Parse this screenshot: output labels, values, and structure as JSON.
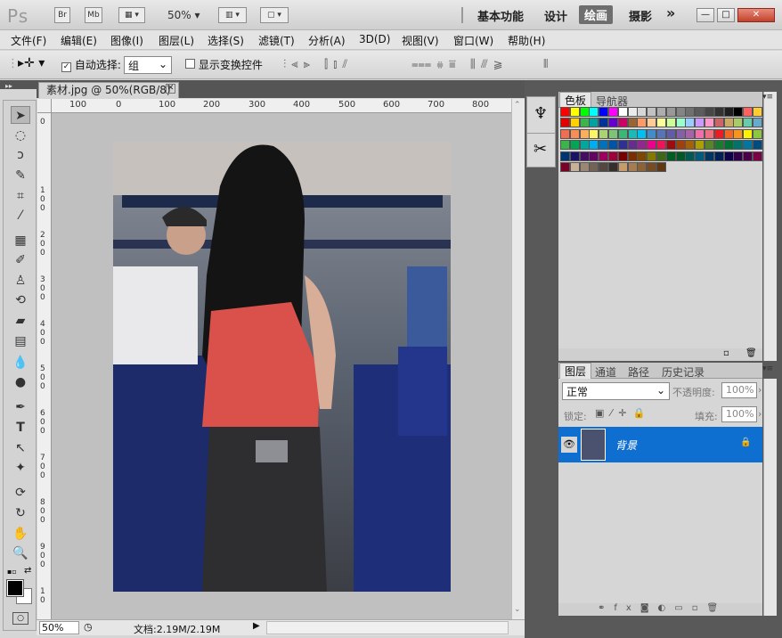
{
  "titlebar": {
    "logo": "Ps",
    "bridge": "Br",
    "minibridge": "Mb",
    "zoom": "50%",
    "workspaces": [
      "基本功能",
      "设计",
      "绘画",
      "摄影"
    ],
    "active_workspace": "绘画",
    "more": "»"
  },
  "menu": [
    "文件(F)",
    "编辑(E)",
    "图像(I)",
    "图层(L)",
    "选择(S)",
    "滤镜(T)",
    "分析(A)",
    "3D(D)",
    "视图(V)",
    "窗口(W)",
    "帮助(H)"
  ],
  "options": {
    "auto_select_label": "自动选择:",
    "auto_select_value": "组",
    "show_transform_label": "显示变换控件"
  },
  "document": {
    "tab_title": "素材.jpg @ 50%(RGB/8)",
    "ruler_top": [
      "100",
      "0",
      "100",
      "200",
      "300",
      "400",
      "500",
      "600",
      "700",
      "800"
    ],
    "ruler_left": [
      "0",
      "1\n0\n0",
      "2\n0\n0",
      "3\n0\n0",
      "4\n0\n0",
      "5\n0\n0",
      "6\n0\n0",
      "7\n0\n0",
      "8\n0\n0",
      "9\n0\n0",
      "1\n0"
    ],
    "zoom": "50%",
    "doc_info": "文档:2.19M/2.19M"
  },
  "panels": {
    "swatch_tabs": [
      "色板",
      "导航器"
    ],
    "layer_tabs": [
      "图层",
      "通道",
      "路径",
      "历史记录"
    ],
    "blend_mode": "正常",
    "opacity_label": "不透明度:",
    "opacity": "100%",
    "lock_label": "锁定:",
    "fill_label": "填充:",
    "fill": "100%",
    "layer_name": "背景"
  },
  "swatch_colors": [
    "#ff0000",
    "#ffff00",
    "#00ff00",
    "#00ffff",
    "#0000ff",
    "#ff00ff",
    "#ffffff",
    "#ebebeb",
    "#d6d6d6",
    "#c2c2c2",
    "#adadad",
    "#999999",
    "#858585",
    "#707070",
    "#5c5c5c",
    "#474747",
    "#333333",
    "#1f1f1f",
    "#000000",
    "#ff6060",
    "#ffcc33",
    "#e50000",
    "#ffd200",
    "#3cb44b",
    "#00a3a3",
    "#003399",
    "#6600cc",
    "#cc0066",
    "#996633",
    "#ff9966",
    "#ffcc99",
    "#ffff99",
    "#ccff99",
    "#99ffcc",
    "#99ccff",
    "#cc99ff",
    "#ff99cc",
    "#cc6666",
    "#ccaa66",
    "#aacc66",
    "#66ccaa",
    "#66aacc",
    "#f26c4f",
    "#f68e56",
    "#fbaf5d",
    "#fff468",
    "#acd373",
    "#7cc576",
    "#3bb878",
    "#1abbb4",
    "#00bff3",
    "#438ccb",
    "#5574b9",
    "#605ca8",
    "#855fa8",
    "#a763a8",
    "#f06ea9",
    "#f26d7d",
    "#ed1c24",
    "#f26522",
    "#f7941d",
    "#fff200",
    "#8dc63f",
    "#39b54a",
    "#00a651",
    "#00a99d",
    "#00aeef",
    "#0072bc",
    "#0054a6",
    "#2e3192",
    "#662d91",
    "#92278f",
    "#ec008c",
    "#ed145b",
    "#9e0b0f",
    "#a0410d",
    "#a36209",
    "#aba000",
    "#598527",
    "#197b30",
    "#007236",
    "#00746b",
    "#0076a3",
    "#004b80",
    "#003471",
    "#1b1464",
    "#440e62",
    "#630460",
    "#9e005d",
    "#9e0039",
    "#790000",
    "#7b2e00",
    "#7d4900",
    "#827b00",
    "#406618",
    "#005e20",
    "#005826",
    "#005952",
    "#005b7f",
    "#003663",
    "#002157",
    "#0d004c",
    "#32004b",
    "#4b0049",
    "#7b0046",
    "#7a0026",
    "#c7b299",
    "#998675",
    "#736357",
    "#534741",
    "#37302a",
    "#c69c6d",
    "#a67c52",
    "#8c6239",
    "#754c24",
    "#603913"
  ]
}
